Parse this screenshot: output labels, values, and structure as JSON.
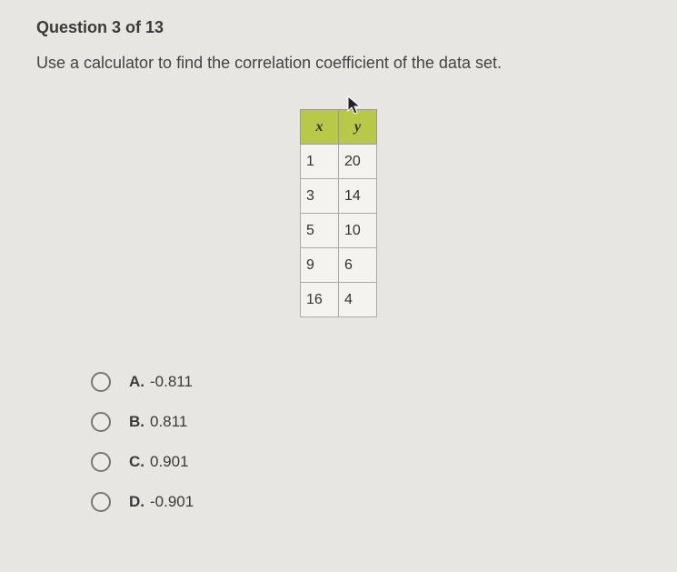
{
  "header": {
    "title": "Question 3 of 13"
  },
  "prompt": "Use a calculator to find the correlation coefficient of the data set.",
  "table": {
    "col_x": "x",
    "col_y": "y",
    "rows": [
      {
        "x": "1",
        "y": "20"
      },
      {
        "x": "3",
        "y": "14"
      },
      {
        "x": "5",
        "y": "10"
      },
      {
        "x": "9",
        "y": "6"
      },
      {
        "x": "16",
        "y": "4"
      }
    ]
  },
  "options": [
    {
      "letter": "A.",
      "text": "-0.811"
    },
    {
      "letter": "B.",
      "text": "0.811"
    },
    {
      "letter": "C.",
      "text": "0.901"
    },
    {
      "letter": "D.",
      "text": "-0.901"
    }
  ]
}
